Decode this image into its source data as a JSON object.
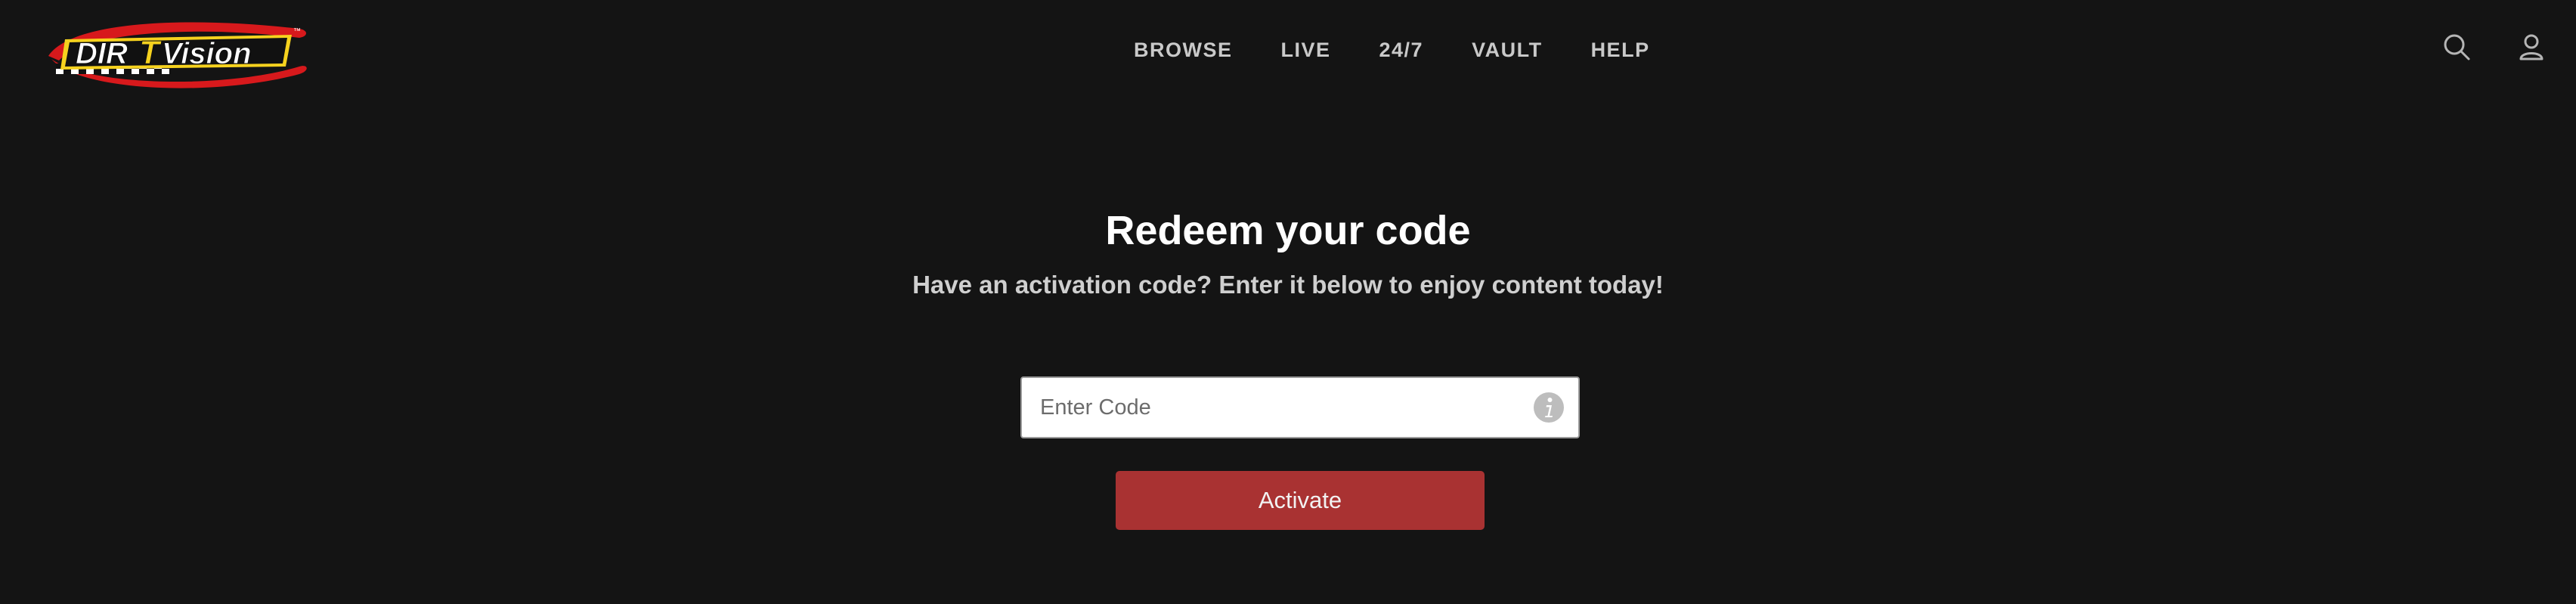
{
  "brand": {
    "logo_text": "DIRTVision",
    "logo_colors": {
      "red": "#d7191c",
      "yellow": "#f6d21e",
      "black": "#111111",
      "white": "#ffffff"
    }
  },
  "nav": {
    "items": [
      {
        "label": "BROWSE"
      },
      {
        "label": "LIVE"
      },
      {
        "label": "24/7"
      },
      {
        "label": "VAULT"
      },
      {
        "label": "HELP"
      }
    ]
  },
  "header_icons": {
    "search": "search-icon",
    "account": "user-icon"
  },
  "redeem": {
    "title": "Redeem your code",
    "subtitle": "Have an activation code? Enter it below to enjoy content today!",
    "input_value": "",
    "input_placeholder": "Enter Code",
    "info_icon": "info-icon",
    "button_label": "Activate"
  },
  "colors": {
    "background": "#141414",
    "nav_text": "#c9c9c9",
    "button": "#a93232",
    "title": "#ffffff"
  }
}
